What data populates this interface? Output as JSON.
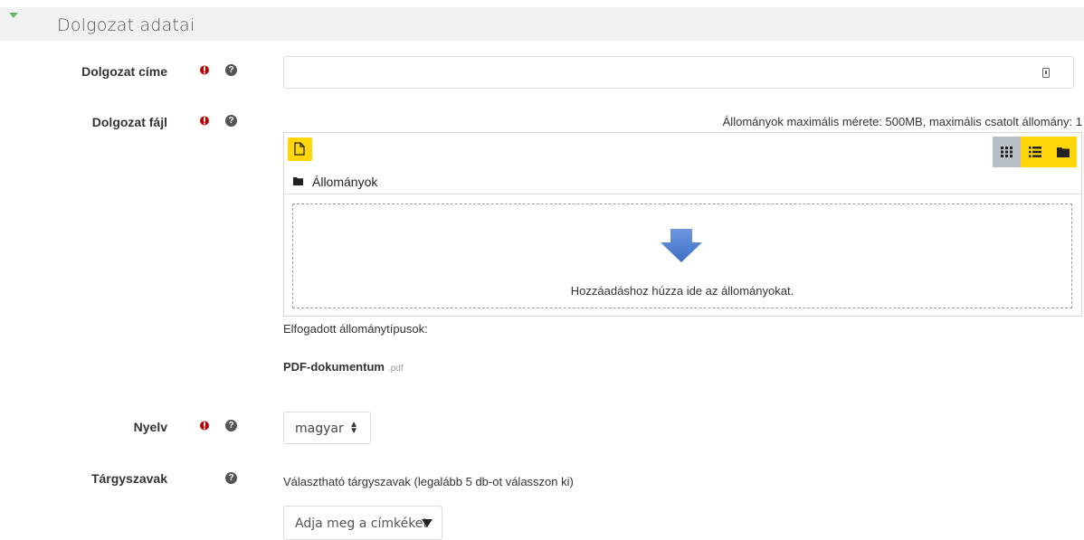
{
  "section": {
    "title": "Dolgozat adatai"
  },
  "fields": {
    "title": {
      "label": "Dolgozat címe",
      "value": ""
    },
    "file": {
      "label": "Dolgozat fájl",
      "limits": "Állományok maximális mérete: 500MB, maximális csatolt állomány: 1",
      "path_label": "Állományok",
      "drop_text": "Hozzáadáshoz húzza ide az állományokat.",
      "accepted_label": "Elfogadott állománytípusok:",
      "accepted_type": "PDF-dokumentum",
      "accepted_ext": ".pdf"
    },
    "language": {
      "label": "Nyelv",
      "selected": "magyar"
    },
    "keywords": {
      "label": "Tárgyszavak",
      "hint": "Választható tárgyszavak (legalább 5 db-ot válasszon ki)",
      "placeholder": "Adja meg a címkéket"
    }
  },
  "colors": {
    "required": "#c00000",
    "accent_yellow": "#ffd60a",
    "section_bg": "#f2f2f2",
    "arrow_blue": "#4a7bd0"
  }
}
